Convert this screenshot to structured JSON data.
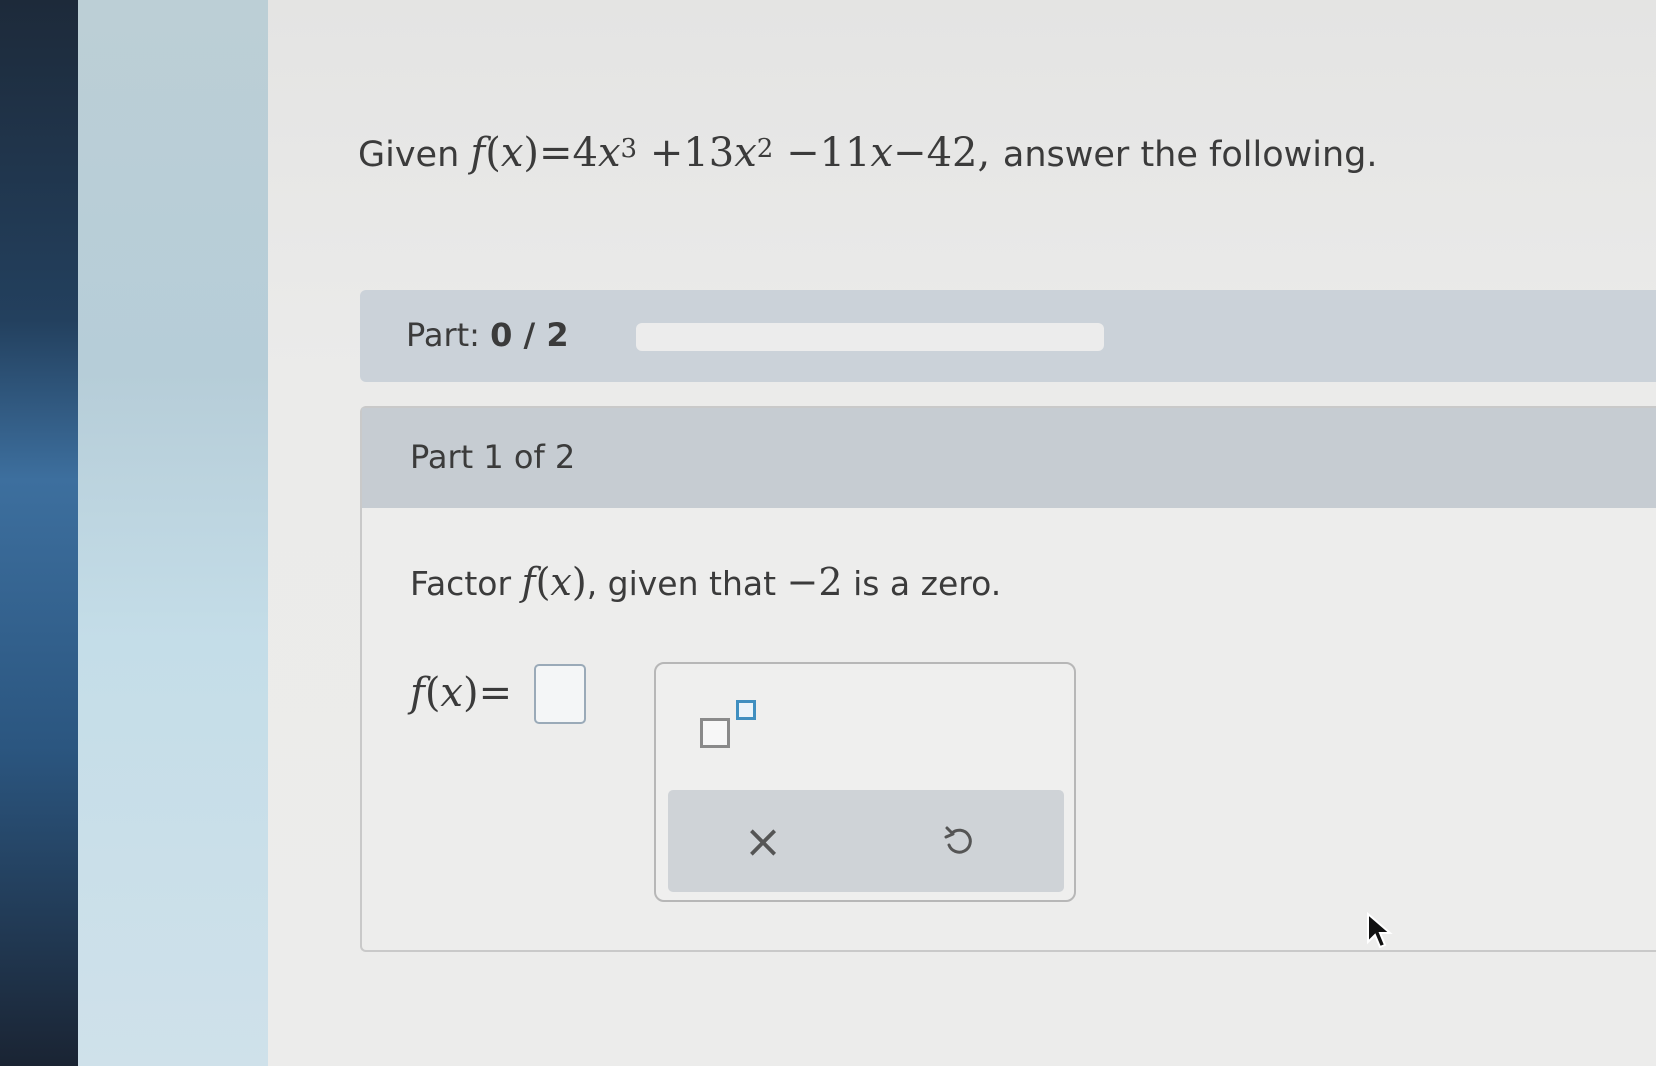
{
  "question": {
    "lead": "Given",
    "func_name": "f",
    "func_var": "x",
    "equals": "=",
    "term1_coef": "4",
    "term1_var": "x",
    "term1_exp": "3",
    "term2": "+13",
    "term2_var": "x",
    "term2_exp": "2",
    "term3": "−11",
    "term3_var": "x",
    "term4": "−42,",
    "tail": "answer the following."
  },
  "progress": {
    "label": "Part:",
    "value": "0 / 2",
    "fraction": 0
  },
  "part": {
    "title": "Part 1 of 2",
    "instruction_lead": "Factor",
    "instruction_func": "f",
    "instruction_var": "x",
    "instruction_mid": ", given that",
    "instruction_value": "−2",
    "instruction_tail": "is a zero."
  },
  "answer": {
    "func": "f",
    "var": "x",
    "equals": "=",
    "value": ""
  },
  "toolbar": {
    "exponent_icon": "superscript-template-icon",
    "clear_symbol": "×",
    "clear_icon": "clear-x-icon",
    "undo_icon": "undo-icon"
  },
  "colors": {
    "progress_fill": "#3b7fc4",
    "input_border": "#9aaab8",
    "superscript_box": "#3f8fc0"
  }
}
